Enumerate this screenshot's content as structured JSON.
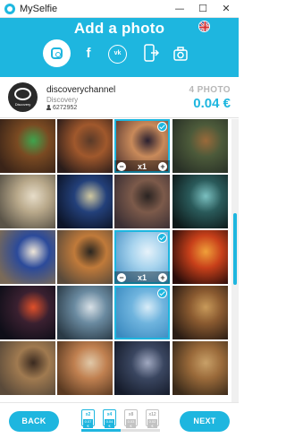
{
  "window": {
    "app_title": "MySelfie",
    "minimize": "—",
    "maximize": "☐",
    "close": "✕"
  },
  "header": {
    "title": "Add a photo",
    "sources": [
      {
        "name": "instagram",
        "active": true
      },
      {
        "name": "facebook",
        "glyph": "f"
      },
      {
        "name": "vk",
        "glyph": "vk"
      },
      {
        "name": "phone-transfer"
      },
      {
        "name": "camera"
      }
    ]
  },
  "profile": {
    "username": "discoverychannel",
    "subtitle": "Discovery",
    "followers": "6272952",
    "avatar_text": "Discovery",
    "photo_count": "4 PHOTO",
    "price": "0.04 €"
  },
  "photos": [
    {
      "img": "lizard"
    },
    {
      "img": "desert-cactus"
    },
    {
      "img": "sunset-rocks",
      "qty": "x1",
      "selected": true
    },
    {
      "img": "tiger-forest"
    },
    {
      "img": "owl"
    },
    {
      "img": "milky-way"
    },
    {
      "img": "deer-mist"
    },
    {
      "img": "rainbow-arch"
    },
    {
      "img": "blue-bird"
    },
    {
      "img": "tiger-cubs"
    },
    {
      "img": "dolphin",
      "qty": "x1",
      "selected": true
    },
    {
      "img": "lava"
    },
    {
      "img": "lava-flow"
    },
    {
      "img": "wildfire"
    },
    {
      "img": "moon",
      "selected": true
    },
    {
      "img": "lioness"
    },
    {
      "img": "big-cats"
    },
    {
      "img": "horses"
    },
    {
      "img": "night-sky"
    },
    {
      "img": "lions"
    }
  ],
  "footer": {
    "back_label": "BACK",
    "next_label": "NEXT",
    "tiers": [
      {
        "mult": "x2",
        "price": "0.07 €",
        "active": true
      },
      {
        "mult": "x4",
        "price": "0.04 €",
        "active": true
      },
      {
        "mult": "x8",
        "price": "0.03 €",
        "active": false
      },
      {
        "mult": "x12",
        "price": "0.02 €",
        "active": false
      }
    ],
    "progress": 0.5
  },
  "colors": {
    "accent": "#1eb6df",
    "header_bg": "#1eb6df"
  }
}
